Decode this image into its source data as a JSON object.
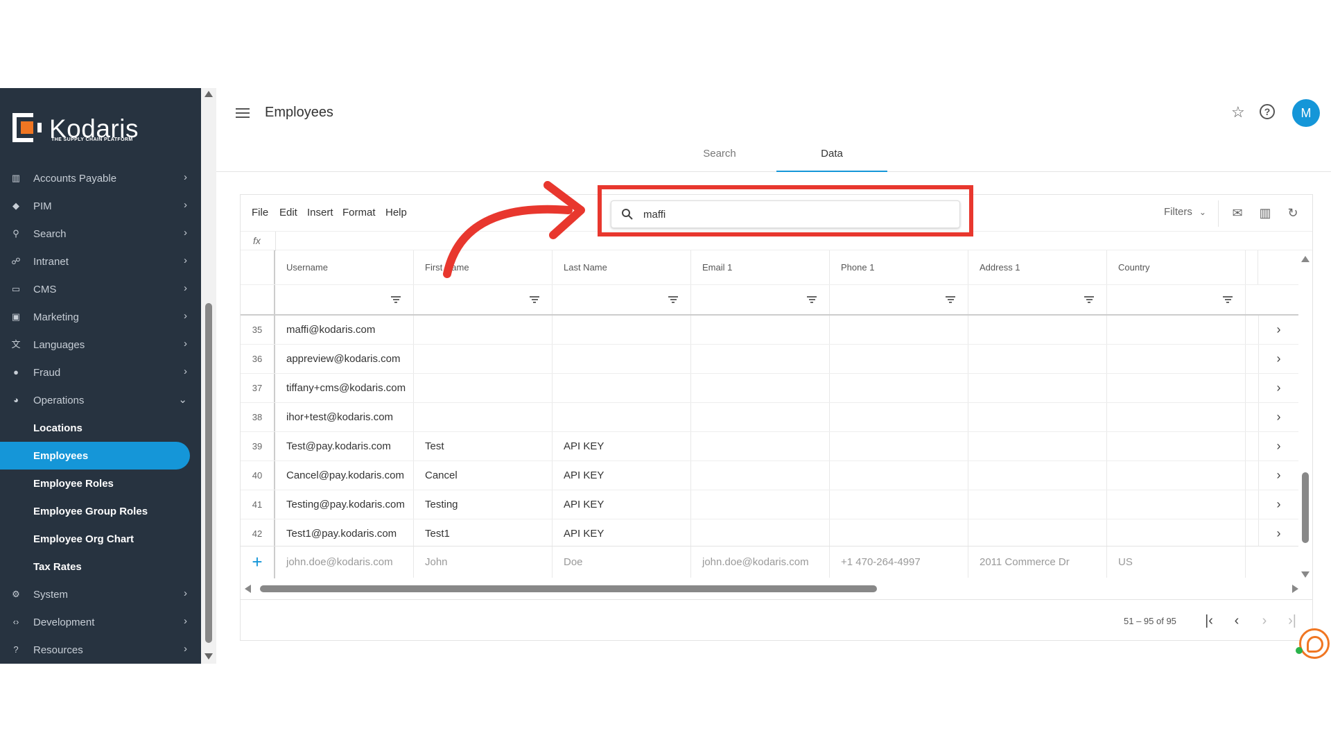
{
  "brand": {
    "name": "Kodaris",
    "tagline": "THE SUPPLY CHAIN PLATFORM"
  },
  "sidebar": {
    "items": [
      {
        "label": "Accounts Payable",
        "icon": "bank-icon"
      },
      {
        "label": "PIM",
        "icon": "tag-icon"
      },
      {
        "label": "Search",
        "icon": "search-icon"
      },
      {
        "label": "Intranet",
        "icon": "network-icon"
      },
      {
        "label": "CMS",
        "icon": "cms-icon"
      },
      {
        "label": "Marketing",
        "icon": "marketing-icon"
      },
      {
        "label": "Languages",
        "icon": "translate-icon"
      },
      {
        "label": "Fraud",
        "icon": "alert-icon"
      },
      {
        "label": "Operations",
        "icon": "palette-icon"
      }
    ],
    "subitems": [
      "Locations",
      "Employees",
      "Employee Roles",
      "Employee Group Roles",
      "Employee Org Chart",
      "Tax Rates"
    ],
    "active_subitem": "Employees",
    "bottom_items": [
      {
        "label": "System",
        "icon": "gear-icon"
      },
      {
        "label": "Development",
        "icon": "code-icon"
      },
      {
        "label": "Resources",
        "icon": "help-circle-icon"
      }
    ]
  },
  "header": {
    "title": "Employees",
    "avatar_initial": "M"
  },
  "tabs": [
    {
      "label": "Search"
    },
    {
      "label": "Data"
    }
  ],
  "active_tab": "Data",
  "toolbar": {
    "menus": [
      "File",
      "Edit",
      "Insert",
      "Format",
      "Help"
    ],
    "search_value": "maffi",
    "filters_label": "Filters"
  },
  "formula_bar": {
    "label": "fx"
  },
  "table": {
    "columns": [
      "Username",
      "First Name",
      "Last Name",
      "Email 1",
      "Phone 1",
      "Address 1",
      "Country"
    ],
    "rows": [
      {
        "num": "35",
        "cells": [
          "maffi@kodaris.com",
          "",
          "",
          "",
          "",
          "",
          ""
        ]
      },
      {
        "num": "36",
        "cells": [
          "appreview@kodaris.com",
          "",
          "",
          "",
          "",
          "",
          ""
        ]
      },
      {
        "num": "37",
        "cells": [
          "tiffany+cms@kodaris.com",
          "",
          "",
          "",
          "",
          "",
          ""
        ]
      },
      {
        "num": "38",
        "cells": [
          "ihor+test@kodaris.com",
          "",
          "",
          "",
          "",
          "",
          ""
        ]
      },
      {
        "num": "39",
        "cells": [
          "Test@pay.kodaris.com",
          "Test",
          "API KEY",
          "",
          "",
          "",
          ""
        ]
      },
      {
        "num": "40",
        "cells": [
          "Cancel@pay.kodaris.com",
          "Cancel",
          "API KEY",
          "",
          "",
          "",
          ""
        ]
      },
      {
        "num": "41",
        "cells": [
          "Testing@pay.kodaris.com",
          "Testing",
          "API KEY",
          "",
          "",
          "",
          ""
        ]
      },
      {
        "num": "42",
        "cells": [
          "Test1@pay.kodaris.com",
          "Test1",
          "API KEY",
          "",
          "",
          "",
          ""
        ]
      }
    ],
    "new_row_placeholders": [
      "john.doe@kodaris.com",
      "John",
      "Doe",
      "john.doe@kodaris.com",
      "+1 470-264-4997",
      "2011 Commerce Dr",
      "US"
    ]
  },
  "pager": {
    "range": "51 – 95 of 95"
  },
  "colors": {
    "accent": "#1596d8",
    "sidebar_bg": "#273340",
    "annotation": "#e8372e"
  }
}
